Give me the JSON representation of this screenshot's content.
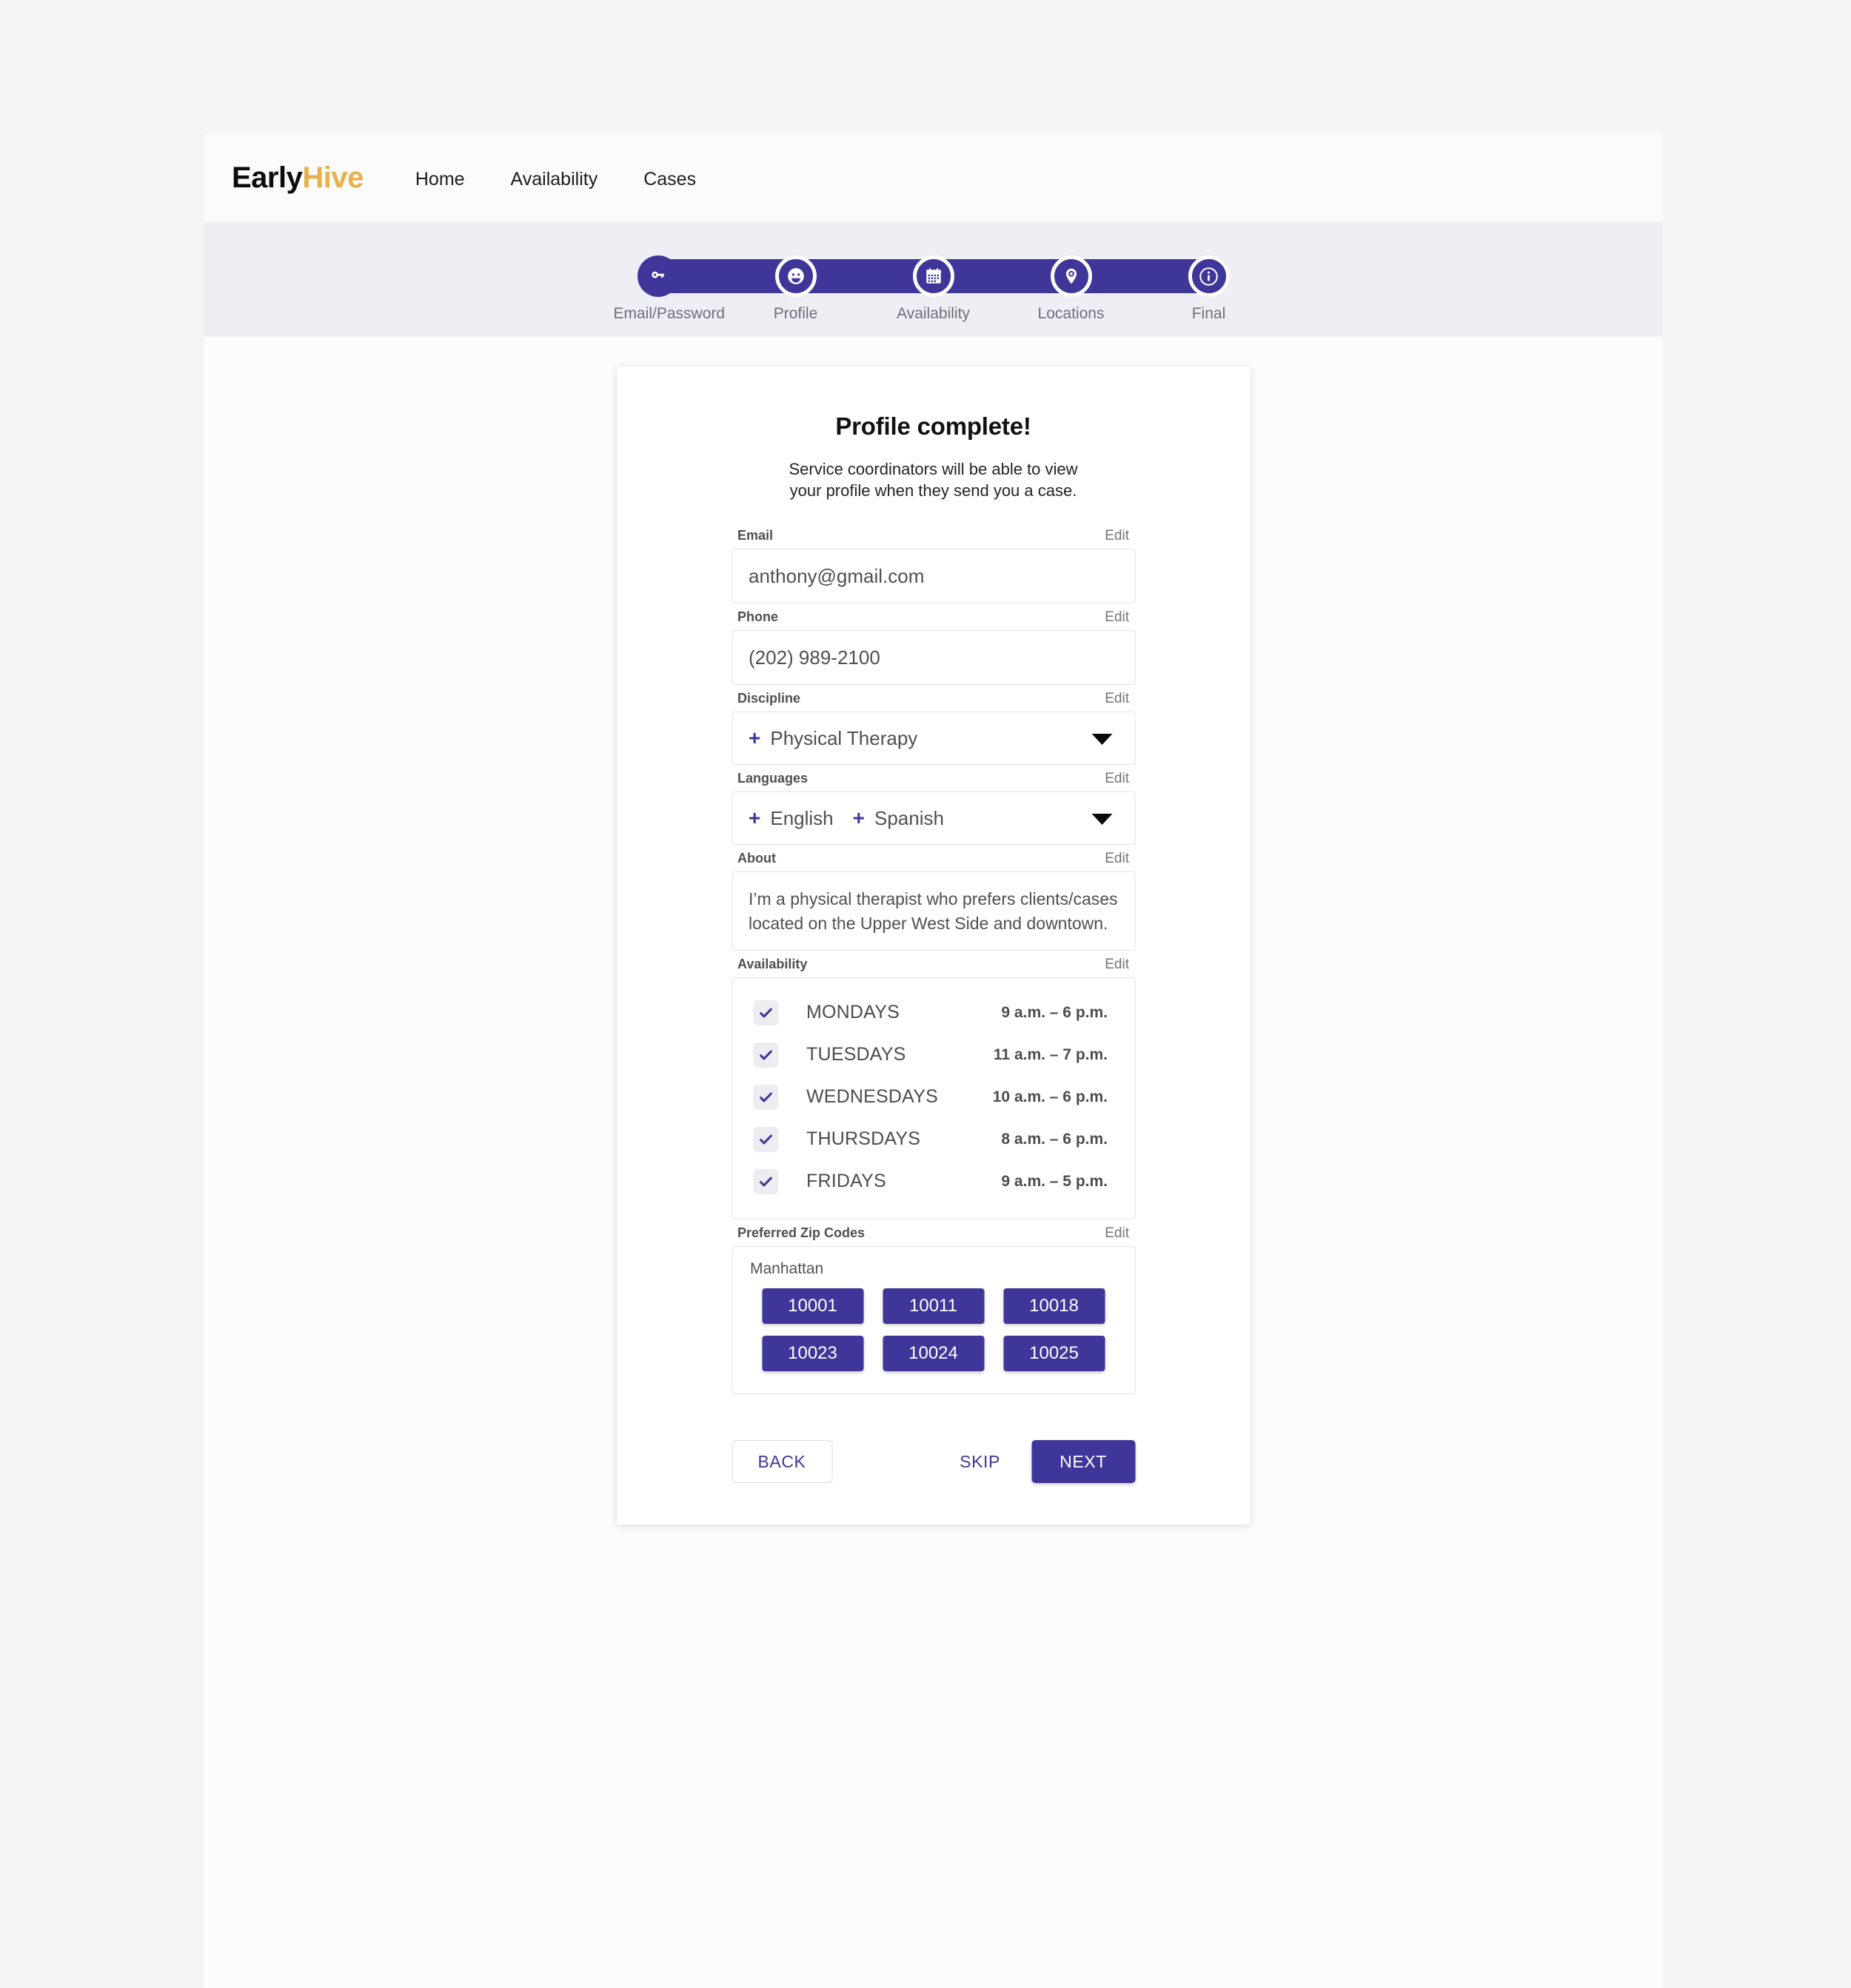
{
  "brand": {
    "first": "Early",
    "second": "Hive",
    "accent_color": "#e8b04b"
  },
  "theme": {
    "primary": "#3e3699",
    "page_bg": "#f4f4f5",
    "band_bg": "#eeeef5"
  },
  "nav": {
    "links": [
      {
        "label": "Home"
      },
      {
        "label": "Availability"
      },
      {
        "label": "Cases"
      }
    ]
  },
  "stepper": {
    "steps": [
      {
        "label": "Email/Password",
        "icon": "key-icon",
        "ringed": false
      },
      {
        "label": "Profile",
        "icon": "face-icon",
        "ringed": true
      },
      {
        "label": "Availability",
        "icon": "calendar-icon",
        "ringed": true
      },
      {
        "label": "Locations",
        "icon": "map-pin-icon",
        "ringed": true
      },
      {
        "label": "Final",
        "icon": "info-icon",
        "ringed": true
      }
    ]
  },
  "card": {
    "title": "Profile complete!",
    "subtitle": "Service coordinators will be able to view your profile when they send you a case.",
    "edit_label": "Edit",
    "email": {
      "label": "Email",
      "value": "anthony@gmail.com"
    },
    "phone": {
      "label": "Phone",
      "value": "(202) 989-2100"
    },
    "discipline": {
      "label": "Discipline",
      "tokens": [
        "Physical Therapy"
      ]
    },
    "languages": {
      "label": "Languages",
      "tokens": [
        "English",
        "Spanish"
      ]
    },
    "about": {
      "label": "About",
      "value": "I’m a physical therapist who prefers clients/cases located on the Upper West Side and downtown."
    },
    "availability": {
      "label": "Availability",
      "rows": [
        {
          "day": "MONDAYS",
          "time": "9 a.m. – 6 p.m.",
          "checked": true
        },
        {
          "day": "TUESDAYS",
          "time": "11 a.m. – 7 p.m.",
          "checked": true
        },
        {
          "day": "WEDNESDAYS",
          "time": "10 a.m. – 6 p.m.",
          "checked": true
        },
        {
          "day": "THURSDAYS",
          "time": "8 a.m. – 6 p.m.",
          "checked": true
        },
        {
          "day": "FRIDAYS",
          "time": "9 a.m. – 5 p.m.",
          "checked": true
        }
      ]
    },
    "zip_codes": {
      "label": "Preferred Zip Codes",
      "region": "Manhattan",
      "codes": [
        "10001",
        "10011",
        "10018",
        "10023",
        "10024",
        "10025"
      ]
    },
    "footer": {
      "back_label": "BACK",
      "skip_label": "SKIP",
      "next_label": "NEXT"
    }
  }
}
